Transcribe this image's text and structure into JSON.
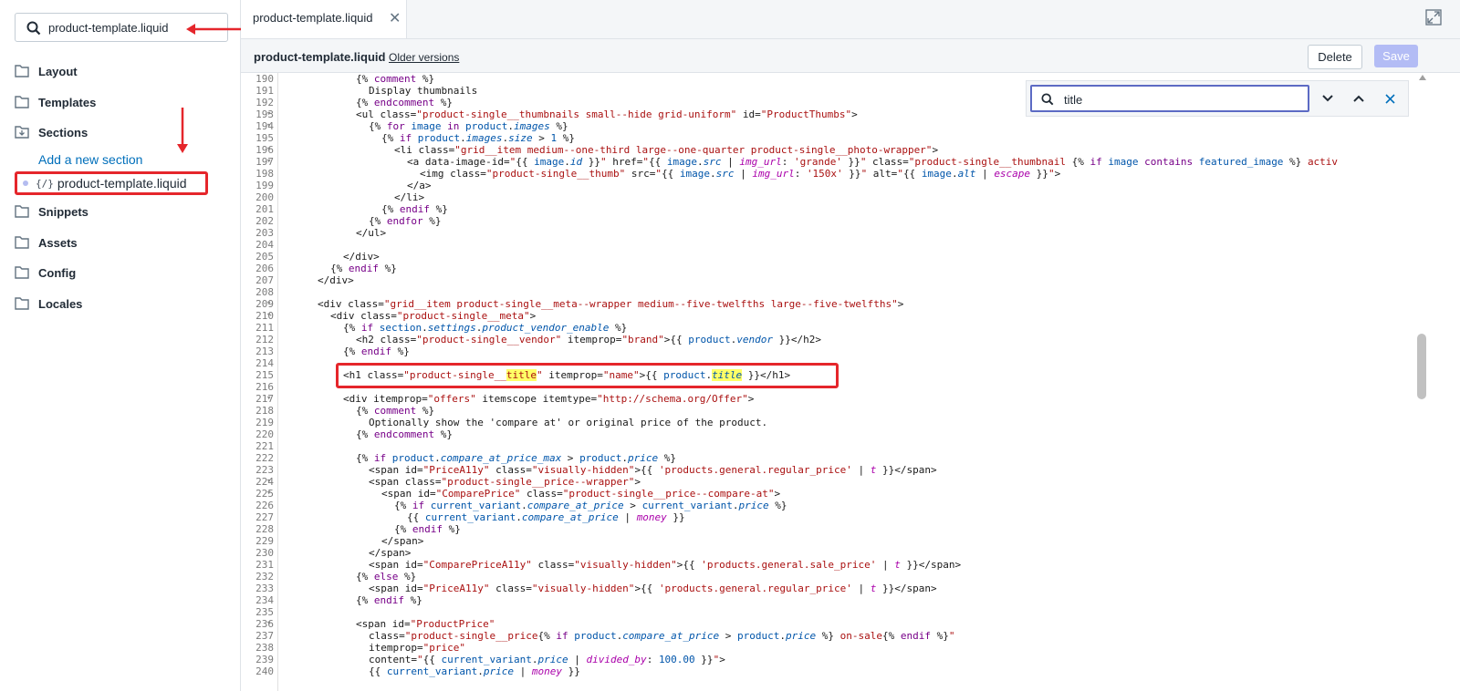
{
  "sidebar": {
    "search_value": "product-template.liquid",
    "folders": {
      "layout": "Layout",
      "templates": "Templates",
      "sections": "Sections",
      "snippets": "Snippets",
      "assets": "Assets",
      "config": "Config",
      "locales": "Locales"
    },
    "add_section": "Add a new section",
    "file_icon": "{/}",
    "file_name": "product-template.liquid"
  },
  "tabbar": {
    "tab_label": "product-template.liquid",
    "close": "✕"
  },
  "fileheader": {
    "name": "product-template.liquid",
    "older_versions": "Older versions",
    "delete": "Delete",
    "save": "Save"
  },
  "find": {
    "query": "title"
  },
  "editor": {
    "line_numbers": [
      "190",
      "191",
      "192",
      "193",
      "194",
      "195",
      "196",
      "197",
      "198",
      "199",
      "200",
      "201",
      "202",
      "203",
      "204",
      "205",
      "206",
      "207",
      "208",
      "209",
      "210",
      "211",
      "212",
      "213",
      "214",
      "215",
      "216",
      "217",
      "218",
      "219",
      "220",
      "221",
      "222",
      "223",
      "224",
      "225",
      "226",
      "227",
      "228",
      "229",
      "230",
      "231",
      "232",
      "233",
      "234",
      "235",
      "236",
      "237",
      "238",
      "239",
      "240"
    ],
    "folded_lines": [
      "193",
      "194",
      "196",
      "197",
      "209",
      "210",
      "217",
      "224",
      "225",
      "236"
    ]
  },
  "colors": {
    "annotation": "#e5262b",
    "link": "#006fbb",
    "save_disabled": "#b3bcf5",
    "find_border": "#5c6ac4",
    "highlight": "#ffff66"
  },
  "icons": [
    "search-icon",
    "folder-icon",
    "folder-open-icon",
    "expand-icon",
    "close-icon",
    "chevron-down-icon",
    "chevron-up-icon",
    "arrow-annotation"
  ]
}
